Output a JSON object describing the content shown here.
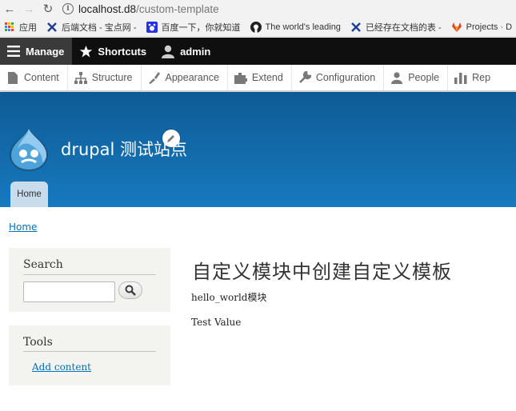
{
  "browser": {
    "url_host": "localhost.d8",
    "url_path": "/custom-template",
    "bookmarks": [
      {
        "label": "应用",
        "icon": "apps-icon"
      },
      {
        "label": "后端文档 - 宝点网 - ",
        "icon": "bookmark-x-icon"
      },
      {
        "label": "百度一下，你就知道",
        "icon": "baidu-icon"
      },
      {
        "label": "The world's leading",
        "icon": "github-icon"
      },
      {
        "label": "已经存在文档的表 - ",
        "icon": "bookmark-x-icon"
      },
      {
        "label": "Projects · D",
        "icon": "gitlab-icon"
      }
    ]
  },
  "toolbar": {
    "manage": "Manage",
    "shortcuts": "Shortcuts",
    "user": "admin"
  },
  "tray": {
    "items": [
      {
        "label": "Content",
        "icon": "content-icon"
      },
      {
        "label": "Structure",
        "icon": "structure-icon"
      },
      {
        "label": "Appearance",
        "icon": "appearance-icon"
      },
      {
        "label": "Extend",
        "icon": "extend-icon"
      },
      {
        "label": "Configuration",
        "icon": "configuration-icon"
      },
      {
        "label": "People",
        "icon": "people-icon"
      },
      {
        "label": "Rep",
        "icon": "reports-icon"
      }
    ]
  },
  "header": {
    "site_name": "drupal 测试站点",
    "home_tab": "Home"
  },
  "breadcrumb": {
    "home": "Home"
  },
  "sidebar": {
    "search_title": "Search",
    "search_placeholder": "",
    "tools_title": "Tools",
    "add_content": "Add content"
  },
  "main": {
    "title": "自定义模块中创建自定义模板",
    "line1": "hello_world模块",
    "line2": "Test Value"
  },
  "colors": {
    "header_top": "#0d5b95",
    "header_bottom": "#1879be",
    "link": "#0071b8",
    "toolbar": "#0f0f0f"
  }
}
